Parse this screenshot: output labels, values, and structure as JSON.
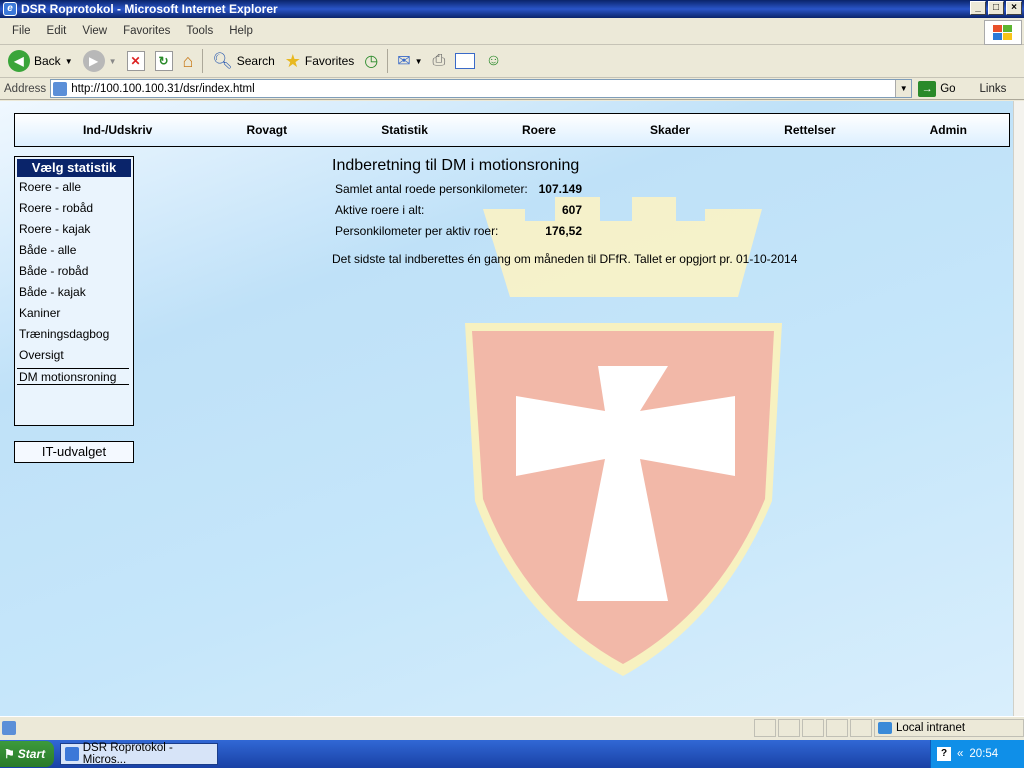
{
  "window": {
    "title": "DSR Roprotokol - Microsoft Internet Explorer"
  },
  "menu": [
    "File",
    "Edit",
    "View",
    "Favorites",
    "Tools",
    "Help"
  ],
  "toolbar": {
    "back": "Back",
    "search": "Search",
    "favorites": "Favorites"
  },
  "address": {
    "label": "Address",
    "url": "http://100.100.100.31/dsr/index.html",
    "go": "Go",
    "links": "Links"
  },
  "nav": [
    "Ind-/Udskriv",
    "Rovagt",
    "Statistik",
    "Roere",
    "Skader",
    "Rettelser",
    "Admin"
  ],
  "sidebar": {
    "title": "Vælg statistik",
    "items": [
      "Roere - alle",
      "Roere - robåd",
      "Roere - kajak",
      "Både - alle",
      "Både - robåd",
      "Både - kajak",
      "Kaniner",
      "Træningsdagbog",
      "Oversigt"
    ],
    "active": "DM motionsroning"
  },
  "it_button": "IT-udvalget",
  "main": {
    "heading": "Indberetning til DM i motionsroning",
    "stats": [
      {
        "label": "Samlet antal roede personkilometer:",
        "value": "107.149"
      },
      {
        "label": "Aktive roere i alt:",
        "value": "607"
      },
      {
        "label": "Personkilometer per aktiv roer:",
        "value": "176,52"
      }
    ],
    "note": "Det sidste tal indberettes én gang om måneden til DFfR. Tallet er opgjort pr. 01-10-2014"
  },
  "status": {
    "zone": "Local intranet"
  },
  "taskbar": {
    "start": "Start",
    "task": "DSR Roprotokol - Micros...",
    "clock": "20:54"
  },
  "colors": {
    "crest_red": "#f2b8a8",
    "crown_yellow": "#fbf3c4",
    "nav_dark": "#0a246a"
  }
}
